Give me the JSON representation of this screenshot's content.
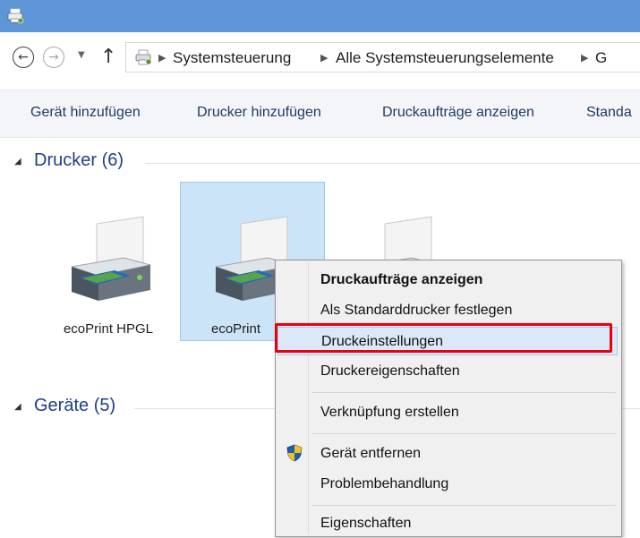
{
  "window": {
    "icon": "printer-control-panel-icon"
  },
  "nav": {
    "back": "back-arrow-icon",
    "forward": "forward-arrow-icon",
    "recent": "recent-locations-icon",
    "up": "up-arrow-icon"
  },
  "address": {
    "icon": "control-panel-printer-icon",
    "breadcrumbs": [
      "Systemsteuerung",
      "Alle Systemsteuerungselemente",
      "G"
    ]
  },
  "commands": [
    "Gerät hinzufügen",
    "Drucker hinzufügen",
    "Druckaufträge anzeigen",
    "Standa"
  ],
  "groups": {
    "printers": {
      "label": "Drucker (6)"
    },
    "devices": {
      "label": "Geräte (5)"
    }
  },
  "printers": [
    {
      "label": "ecoPrint HPGL",
      "selected": false
    },
    {
      "label": "ecoPrint",
      "selected": true
    },
    {
      "label": "",
      "selected": false
    }
  ],
  "context_menu": {
    "items": [
      {
        "label": "Druckaufträge anzeigen",
        "bold": true
      },
      {
        "label": "Als Standarddrucker festlegen",
        "bold": false
      },
      {
        "label": "Druckeinstellungen",
        "bold": false,
        "highlighted": true
      },
      {
        "label": "Druckereigenschaften",
        "bold": false
      },
      {
        "label": "Verknüpfung erstellen",
        "bold": false
      },
      {
        "label": "Gerät entfernen",
        "bold": false,
        "icon": "uac-shield-icon"
      },
      {
        "label": "Problembehandlung",
        "bold": false
      },
      {
        "label": "Eigenschaften",
        "bold": false
      }
    ]
  },
  "colors": {
    "titlebar": "#5d95d6",
    "selection": "#cce4f7",
    "annotation_box": "#e8000b",
    "group_header": "#1f3e8c"
  }
}
